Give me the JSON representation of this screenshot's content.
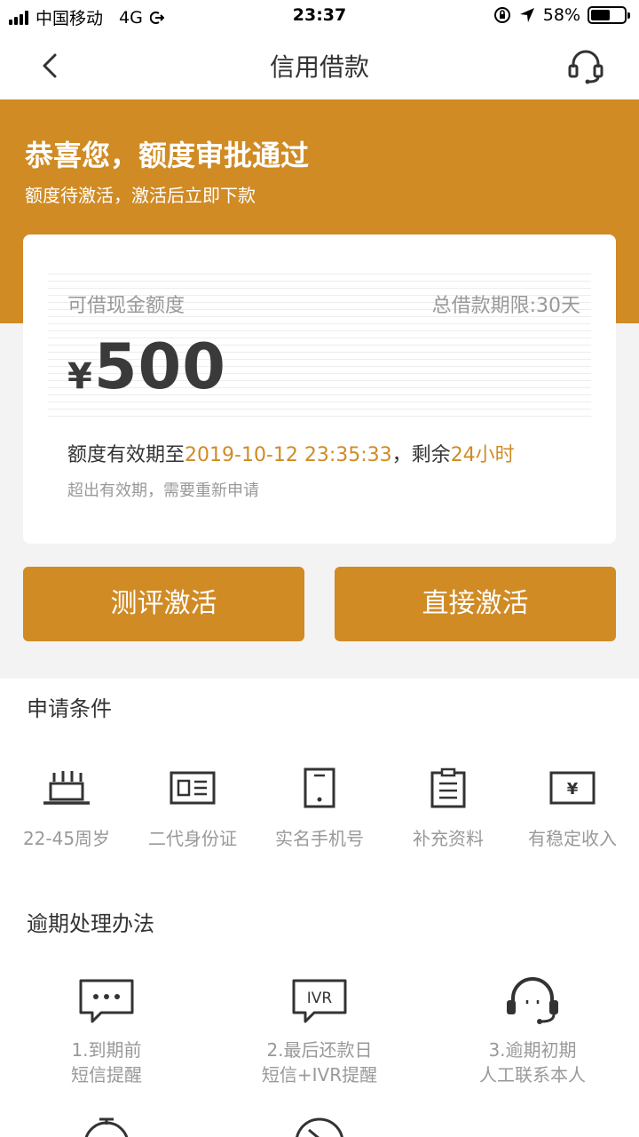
{
  "status_bar": {
    "carrier": "中国移动",
    "network": "4G",
    "time": "23:37",
    "battery": "58%",
    "battery_level": 0.58
  },
  "nav": {
    "title": "信用借款",
    "back_icon": "chevron-left-icon",
    "service_icon": "headset-icon"
  },
  "hero": {
    "title": "恭喜您，额度审批通过",
    "subtitle": "额度待激活，激活后立即下款"
  },
  "credit_card": {
    "label": "可借现金额度",
    "term": "总借款期限:30天",
    "currency": "¥",
    "amount": "500",
    "validity_prefix": "额度有效期至",
    "validity_date": "2019-10-12 23:35:33",
    "validity_mid": "，剩余",
    "validity_remaining": "24小时",
    "note": "超出有效期，需要重新申请"
  },
  "buttons": {
    "evaluate": "测评激活",
    "direct": "直接激活"
  },
  "conditions": {
    "title": "申请条件",
    "items": [
      {
        "label": "22-45周岁",
        "icon": "birthday-cake-icon"
      },
      {
        "label": "二代身份证",
        "icon": "id-card-icon"
      },
      {
        "label": "实名手机号",
        "icon": "mobile-phone-icon"
      },
      {
        "label": "补充资料",
        "icon": "clipboard-icon"
      },
      {
        "label": "有稳定收入",
        "icon": "income-card-icon"
      }
    ]
  },
  "overdue": {
    "title": "逾期处理办法",
    "items": [
      {
        "line1": "1.到期前",
        "line2": "短信提醒",
        "icon": "sms-bubble-icon"
      },
      {
        "line1": "2.最后还款日",
        "line2": "短信+IVR提醒",
        "icon": "ivr-bubble-icon",
        "badge": "IVR"
      },
      {
        "line1": "3.逾期初期",
        "line2": "人工联系本人",
        "icon": "headset-icon"
      }
    ]
  },
  "colors": {
    "accent": "#d08b24",
    "background": "#f3f3f3"
  }
}
